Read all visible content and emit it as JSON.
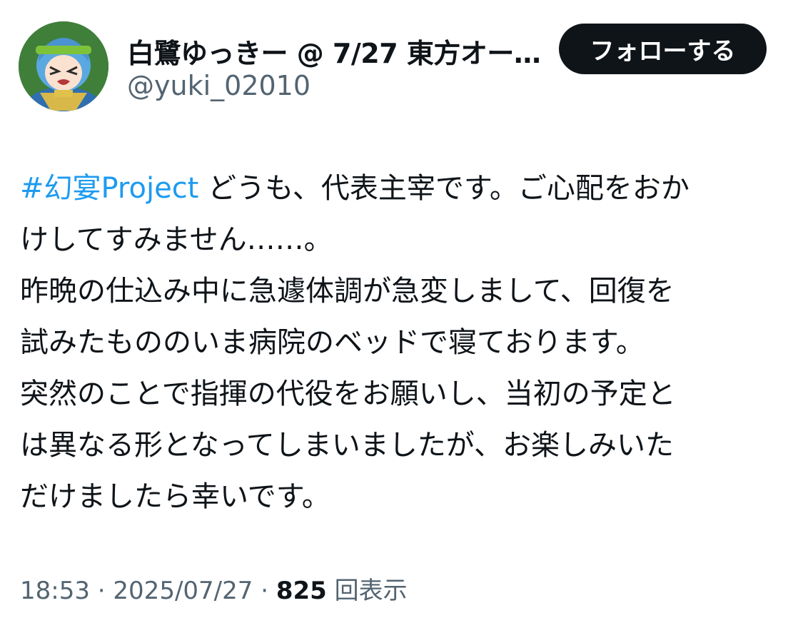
{
  "author": {
    "display_name": "白鷺ゆっきー @ 7/27 東方オー…",
    "handle": "@yuki_02010",
    "avatar_icon": "anime-character-avatar"
  },
  "follow_button": {
    "label": "フォローする"
  },
  "tweet": {
    "hashtag": "#幻宴Project",
    "lines": [
      " どうも、代表主宰です。ご心配をおか",
      "けしてすみません……。",
      "昨晩の仕込み中に急遽体調が急変しまして、回復を",
      "試みたもののいま病院のベッドで寝ております。",
      "突然のことで指揮の代役をお願いし、当初の予定と",
      "は異なる形となってしまいましたが、お楽しみいた",
      "だけましたら幸いです。"
    ]
  },
  "meta": {
    "time": "18:53",
    "separator": " · ",
    "date": "2025/07/27",
    "views_count": "825",
    "views_label": " 回表示"
  },
  "colors": {
    "text": "#0f1419",
    "secondary": "#536471",
    "link": "#1d9bf0",
    "button_bg": "#0f1419",
    "button_text": "#ffffff"
  }
}
